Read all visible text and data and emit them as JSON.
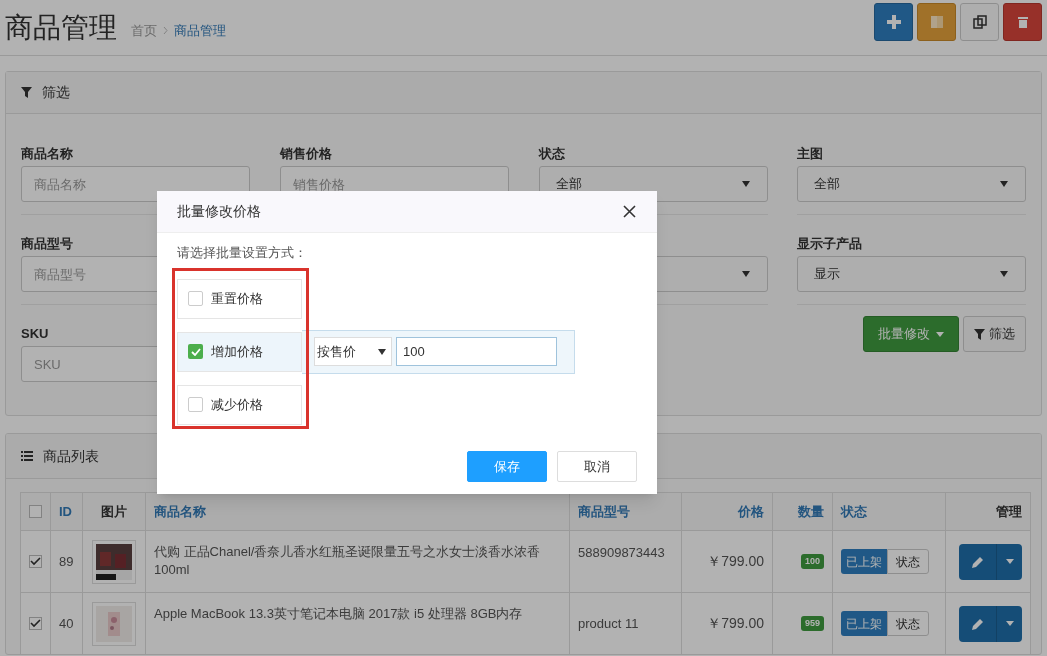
{
  "header": {
    "title": "商品管理",
    "breadcrumb": [
      {
        "label": "首页",
        "current": false
      },
      {
        "label": "商品管理",
        "current": true
      }
    ],
    "actions": [
      {
        "kind": "add"
      },
      {
        "kind": "import"
      },
      {
        "kind": "copy"
      },
      {
        "kind": "delete"
      }
    ]
  },
  "filter": {
    "title": "筛选",
    "rows": [
      [
        {
          "label": "商品名称",
          "kind": "input",
          "placeholder": "商品名称"
        },
        {
          "label": "销售价格",
          "kind": "input",
          "placeholder": "销售价格"
        },
        {
          "label": "状态",
          "kind": "select",
          "value": "全部"
        },
        {
          "label": "主图",
          "kind": "select",
          "value": "全部"
        }
      ],
      [
        {
          "label": "商品型号",
          "kind": "input",
          "placeholder": "商品型号"
        },
        {
          "kind": "blank"
        },
        {
          "kind": "select"
        },
        {
          "label": "显示子产品",
          "kind": "select",
          "value": "显示"
        }
      ],
      [
        {
          "label": "SKU",
          "kind": "input",
          "placeholder": "SKU"
        }
      ]
    ],
    "batch_button": "批量修改",
    "filter_button": "筛选"
  },
  "products": {
    "title": "商品列表",
    "columns": [
      {
        "kind": "check",
        "checked": false
      },
      {
        "label": "ID",
        "sortable": true
      },
      {
        "label": "图片",
        "sortable": false
      },
      {
        "label": "商品名称",
        "sortable": true
      },
      {
        "label": "商品型号",
        "sortable": true
      },
      {
        "label": "价格",
        "sortable": true
      },
      {
        "label": "数量",
        "sortable": true
      },
      {
        "label": "状态",
        "sortable": true
      },
      {
        "label": "管理",
        "sortable": false
      }
    ],
    "rows": [
      {
        "checked": true,
        "id": "89",
        "name": "代购 正品Chanel/香奈儿香水红瓶圣诞限量五号之水女士淡香水浓香100ml",
        "model": "588909873443",
        "price": "￥799.00",
        "quantity": "100",
        "status": "已上架",
        "status_button": "状态"
      },
      {
        "checked": true,
        "id": "40",
        "name": "Apple MacBook 13.3英寸笔记本电脑 2017款 i5 处理器 8GB内存",
        "model": "product 11",
        "price": "￥799.00",
        "quantity": "959",
        "status": "已上架",
        "status_button": "状态"
      }
    ]
  },
  "dialog": {
    "title": "批量修改价格",
    "prompt": "请选择批量设置方式：",
    "options": [
      {
        "label": "重置价格",
        "checked": false
      },
      {
        "label": "增加价格",
        "checked": true
      },
      {
        "label": "减少价格",
        "checked": false
      }
    ],
    "method": "按售价",
    "amount": "100",
    "buttons": [
      {
        "label": "保存",
        "kind": "primary"
      },
      {
        "label": "取消",
        "kind": "default"
      }
    ]
  }
}
